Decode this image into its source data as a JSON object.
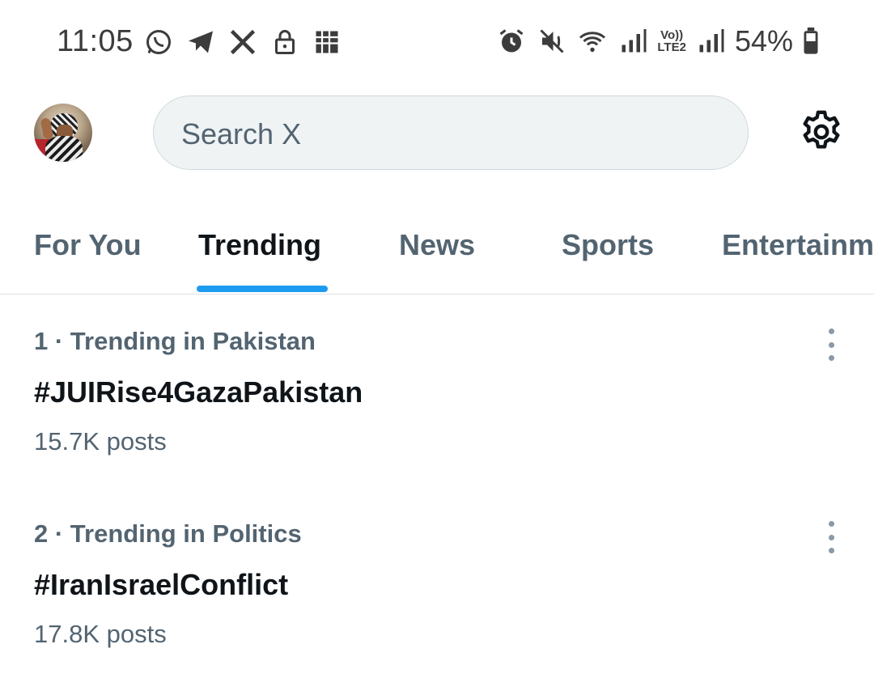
{
  "status_bar": {
    "time": "11:05",
    "left_icons": [
      "whatsapp-icon",
      "telegram-icon",
      "x-logo-icon",
      "lock-icon",
      "gallery-icon"
    ],
    "right_icons": [
      "alarm-icon",
      "mute-icon",
      "wifi-icon",
      "signal-icon",
      "volte-icon",
      "signal-icon-2",
      "battery-icon"
    ],
    "volte_line1": "Vo))",
    "volte_line2": "LTE2",
    "battery": "54%"
  },
  "header": {
    "search_placeholder": "Search X",
    "settings_icon": "gear-icon"
  },
  "tabs": [
    {
      "label": "For You",
      "active": false
    },
    {
      "label": "Trending",
      "active": true
    },
    {
      "label": "News",
      "active": false
    },
    {
      "label": "Sports",
      "active": false
    },
    {
      "label": "Entertainm",
      "active": false
    }
  ],
  "trends": [
    {
      "meta": "1 · Trending in Pakistan",
      "title": "#JUIRise4GazaPakistan",
      "count": "15.7K posts"
    },
    {
      "meta": "2 · Trending in Politics",
      "title": "#IranIsraelConflict",
      "count": "17.8K posts"
    }
  ],
  "colors": {
    "accent": "#1d9bf0",
    "primary_text": "#0f1419",
    "secondary_text": "#536471",
    "search_bg": "#eff3f4"
  }
}
